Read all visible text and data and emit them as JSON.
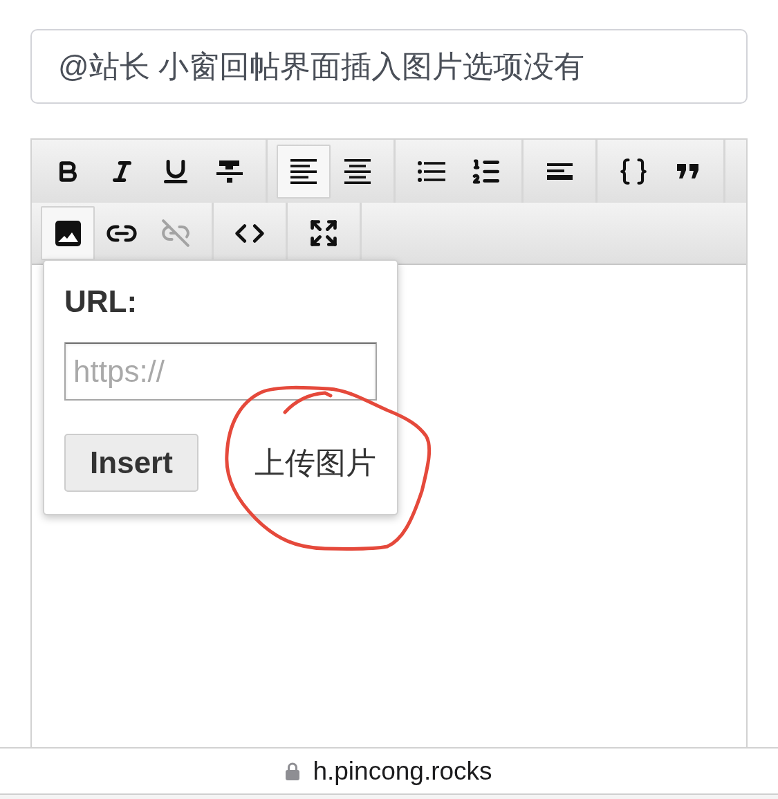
{
  "title_field": {
    "value": "@站长 小窗回帖界面插入图片选项没有"
  },
  "toolbar": {
    "rows": [
      {
        "groups": [
          {
            "buttons": [
              {
                "kind": "bold",
                "active": false,
                "disabled": false
              },
              {
                "kind": "italic",
                "active": false,
                "disabled": false
              },
              {
                "kind": "underline",
                "active": false,
                "disabled": false
              },
              {
                "kind": "strikethrough",
                "active": false,
                "disabled": false
              }
            ]
          },
          {
            "buttons": [
              {
                "kind": "align_left",
                "active": true,
                "disabled": false
              },
              {
                "kind": "align_center",
                "active": false,
                "disabled": false
              }
            ]
          },
          {
            "buttons": [
              {
                "kind": "bullet_list",
                "active": false,
                "disabled": false
              },
              {
                "kind": "numbered_list",
                "active": false,
                "disabled": false
              }
            ]
          },
          {
            "buttons": [
              {
                "kind": "horizontal_rule",
                "active": false,
                "disabled": false
              }
            ]
          },
          {
            "buttons": [
              {
                "kind": "code_block",
                "active": false,
                "disabled": false
              },
              {
                "kind": "quote",
                "active": false,
                "disabled": false
              }
            ]
          }
        ]
      },
      {
        "groups": [
          {
            "buttons": [
              {
                "kind": "image",
                "active": true,
                "disabled": false
              },
              {
                "kind": "link",
                "active": false,
                "disabled": false
              },
              {
                "kind": "unlink",
                "active": false,
                "disabled": true
              }
            ]
          },
          {
            "buttons": [
              {
                "kind": "code_view",
                "active": false,
                "disabled": false
              }
            ]
          },
          {
            "buttons": [
              {
                "kind": "fullscreen",
                "active": false,
                "disabled": false
              }
            ]
          }
        ]
      }
    ]
  },
  "image_popup": {
    "label": "URL:",
    "url_field": {
      "placeholder": "https://"
    },
    "insert_button": "Insert",
    "upload_button": "上传图片"
  },
  "address_bar": {
    "secure": true,
    "url": "h.pincong.rocks"
  }
}
